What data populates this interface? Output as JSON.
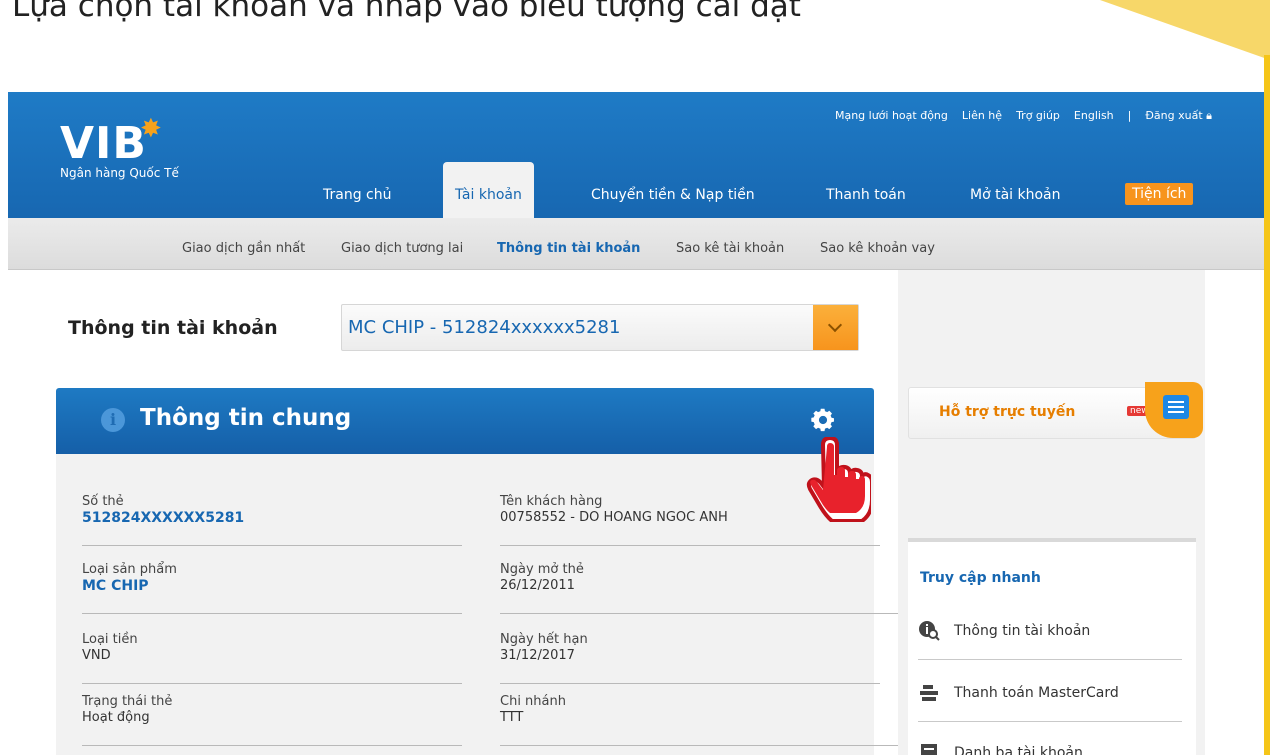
{
  "tutorial": {
    "title": "Lựa chọn tài khoản và nhấp vào biểu tượng cài đặt"
  },
  "header": {
    "logo_text": "VIB",
    "logo_tagline": "Ngân hàng Quốc Tế",
    "top_links": [
      "Mạng lưới hoạt động",
      "Liên hệ",
      "Trợ giúp",
      "English",
      "|",
      "Đăng xuất"
    ],
    "nav": [
      "Trang chủ",
      "Tài khoản",
      "Chuyển tiền & Nạp tiền",
      "Thanh toán",
      "Mở tài khoản",
      "Tiện ích"
    ],
    "active_nav": "Tài khoản"
  },
  "subnav": [
    "Giao dịch gần nhất",
    "Giao dịch tương lai",
    "Thông tin tài khoản",
    "Sao kê tài khoản",
    "Sao kê khoản vay"
  ],
  "account": {
    "label": "Thông tin tài khoản",
    "selected": "MC CHIP - 512824xxxxxx5281"
  },
  "panel": {
    "title": "Thông tin chung",
    "fields": [
      {
        "label": "Số thẻ",
        "value": "512824XXXXXX5281"
      },
      {
        "label": "Tên khách hàng",
        "value": "00758552 - DO HOANG NGOC ANH"
      },
      {
        "label": "Loại sản phẩm",
        "value": "MC CHIP"
      },
      {
        "label": "Ngày mở thẻ",
        "value": "26/12/2011"
      },
      {
        "label": "Loại tiền",
        "value": "VND"
      },
      {
        "label": "Ngày hết hạn",
        "value": "31/12/2017"
      },
      {
        "label": "Trạng thái thẻ",
        "value": "Hoạt động"
      },
      {
        "label": "Chi nhánh",
        "value": "TTT"
      }
    ]
  },
  "sidebar": {
    "support_label": "Hỗ trợ trực tuyến",
    "new_badge": "new",
    "quick_title": "Truy cập nhanh",
    "quick_items": [
      "Thông tin tài khoản",
      "Thanh toán MasterCard",
      "Danh bạ tài khoản"
    ]
  },
  "colors": {
    "brand_blue": "#1767b1",
    "accent_orange": "#f7941d",
    "corner_yellow": "#f7d769"
  }
}
